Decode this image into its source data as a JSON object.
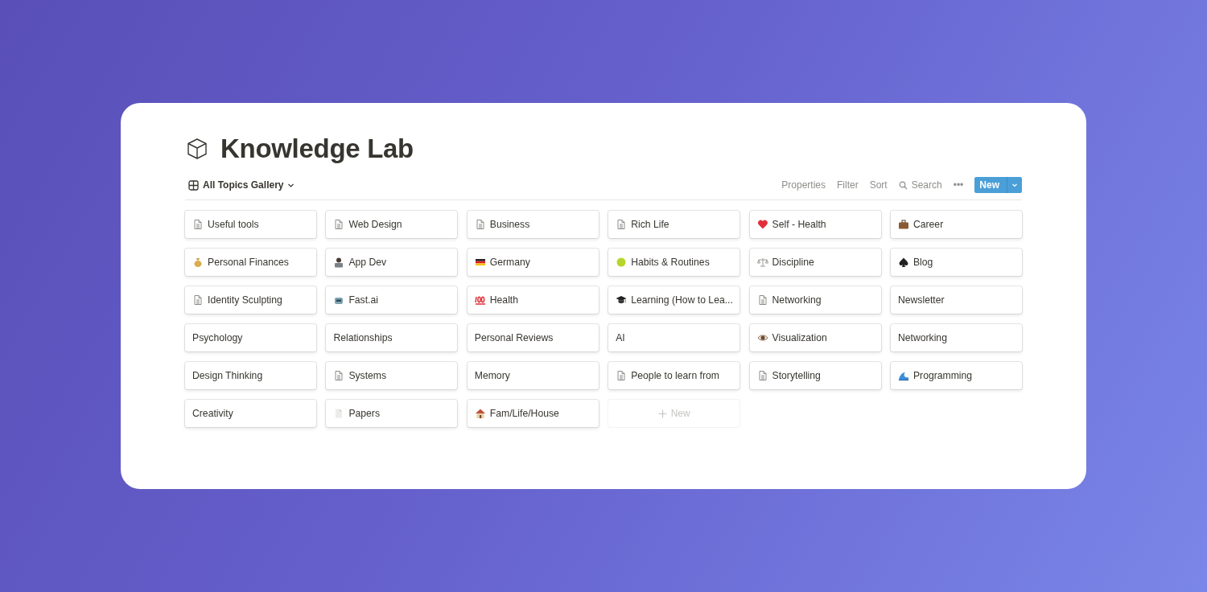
{
  "page": {
    "title": "Knowledge Lab"
  },
  "view": {
    "label": "All Topics Gallery"
  },
  "toolbar": {
    "actions": [
      "Properties",
      "Filter",
      "Sort"
    ],
    "search": "Search",
    "more": "•••",
    "new_button": "New"
  },
  "cards": [
    {
      "title": "Useful tools",
      "kind": "page"
    },
    {
      "title": "Web Design",
      "kind": "page"
    },
    {
      "title": "Business",
      "kind": "page"
    },
    {
      "title": "Rich Life",
      "kind": "page"
    },
    {
      "title": "Self - Health",
      "kind": "heart"
    },
    {
      "title": "Career",
      "kind": "briefcase"
    },
    {
      "title": "Personal Finances",
      "kind": "moneybag"
    },
    {
      "title": "App Dev",
      "kind": "person"
    },
    {
      "title": "Germany",
      "kind": "flag"
    },
    {
      "title": "Habits & Routines",
      "kind": "ball"
    },
    {
      "title": "Discipline",
      "kind": "scales"
    },
    {
      "title": "Blog",
      "kind": "spade"
    },
    {
      "title": "Identity Sculpting",
      "kind": "page"
    },
    {
      "title": "Fast.ai",
      "kind": "robot"
    },
    {
      "title": "Health",
      "kind": "hundred"
    },
    {
      "title": "Learning (How to Lea...",
      "kind": "cap"
    },
    {
      "title": "Networking",
      "kind": "page"
    },
    {
      "title": "Newsletter",
      "kind": "plain"
    },
    {
      "title": "Psychology",
      "kind": "plain"
    },
    {
      "title": "Relationships",
      "kind": "plain"
    },
    {
      "title": "Personal Reviews",
      "kind": "plain"
    },
    {
      "title": "AI",
      "kind": "plain"
    },
    {
      "title": "Visualization",
      "kind": "eye"
    },
    {
      "title": "Networking",
      "kind": "plain"
    },
    {
      "title": "Design Thinking",
      "kind": "plain"
    },
    {
      "title": "Systems",
      "kind": "page"
    },
    {
      "title": "Memory",
      "kind": "plain"
    },
    {
      "title": "People to learn from",
      "kind": "page"
    },
    {
      "title": "Storytelling",
      "kind": "page"
    },
    {
      "title": "Programming",
      "kind": "wave"
    },
    {
      "title": "Creativity",
      "kind": "plain"
    },
    {
      "title": "Papers",
      "kind": "paper"
    },
    {
      "title": "Fam/Life/House",
      "kind": "house"
    }
  ],
  "new_card": {
    "label": "New"
  }
}
